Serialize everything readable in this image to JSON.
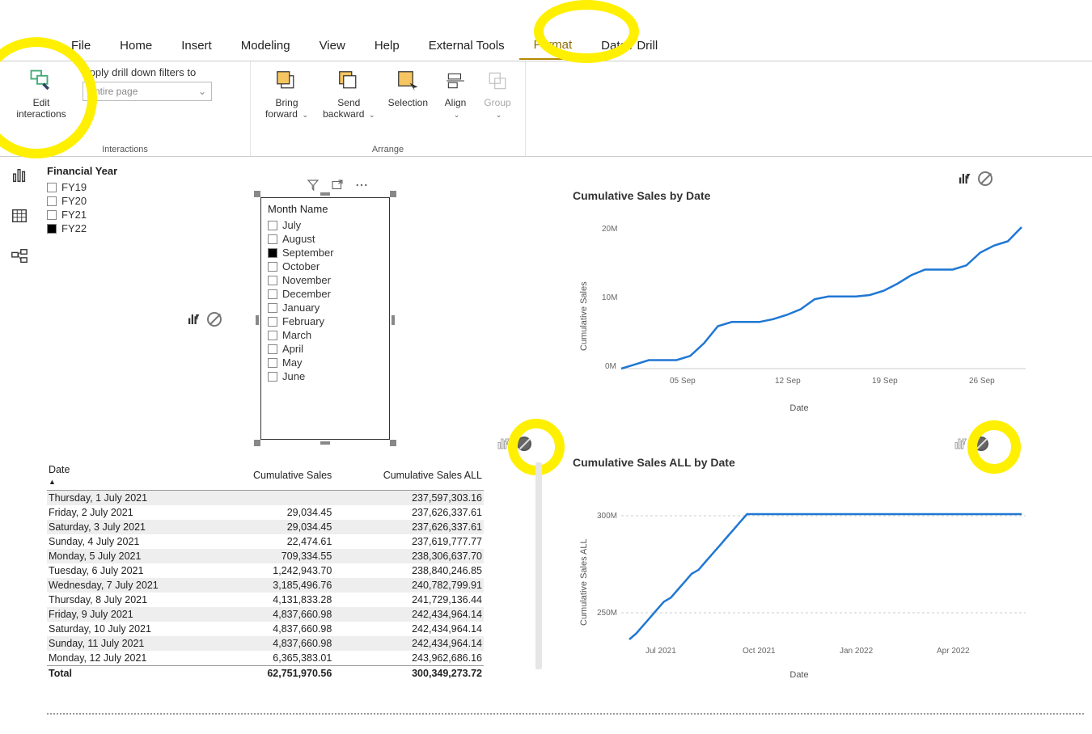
{
  "menu": {
    "items": [
      "File",
      "Home",
      "Insert",
      "Modeling",
      "View",
      "Help",
      "External Tools",
      "Format",
      "Data / Drill"
    ],
    "active": "Format"
  },
  "ribbon": {
    "interactions": {
      "edit_label": "Edit interactions",
      "drill_label": "Apply drill down filters to",
      "drill_value": "Entire page",
      "group_label": "Interactions"
    },
    "arrange": {
      "bring_forward": "Bring forward",
      "send_backward": "Send backward",
      "selection": "Selection",
      "align": "Align",
      "group": "Group",
      "group_label": "Arrange"
    }
  },
  "fy_slicer": {
    "title": "Financial Year",
    "items": [
      {
        "label": "FY19",
        "checked": false
      },
      {
        "label": "FY20",
        "checked": false
      },
      {
        "label": "FY21",
        "checked": false
      },
      {
        "label": "FY22",
        "checked": true
      }
    ]
  },
  "month_slicer": {
    "title": "Month Name",
    "items": [
      {
        "label": "July",
        "checked": false
      },
      {
        "label": "August",
        "checked": false
      },
      {
        "label": "September",
        "checked": true
      },
      {
        "label": "October",
        "checked": false
      },
      {
        "label": "November",
        "checked": false
      },
      {
        "label": "December",
        "checked": false
      },
      {
        "label": "January",
        "checked": false
      },
      {
        "label": "February",
        "checked": false
      },
      {
        "label": "March",
        "checked": false
      },
      {
        "label": "April",
        "checked": false
      },
      {
        "label": "May",
        "checked": false
      },
      {
        "label": "June",
        "checked": false
      }
    ]
  },
  "table": {
    "columns": [
      "Date",
      "Cumulative Sales",
      "Cumulative Sales ALL"
    ],
    "rows": [
      [
        "Thursday, 1 July 2021",
        "",
        "237,597,303.16"
      ],
      [
        "Friday, 2 July 2021",
        "29,034.45",
        "237,626,337.61"
      ],
      [
        "Saturday, 3 July 2021",
        "29,034.45",
        "237,626,337.61"
      ],
      [
        "Sunday, 4 July 2021",
        "22,474.61",
        "237,619,777.77"
      ],
      [
        "Monday, 5 July 2021",
        "709,334.55",
        "238,306,637.70"
      ],
      [
        "Tuesday, 6 July 2021",
        "1,242,943.70",
        "238,840,246.85"
      ],
      [
        "Wednesday, 7 July 2021",
        "3,185,496.76",
        "240,782,799.91"
      ],
      [
        "Thursday, 8 July 2021",
        "4,131,833.28",
        "241,729,136.44"
      ],
      [
        "Friday, 9 July 2021",
        "4,837,660.98",
        "242,434,964.14"
      ],
      [
        "Saturday, 10 July 2021",
        "4,837,660.98",
        "242,434,964.14"
      ],
      [
        "Sunday, 11 July 2021",
        "4,837,660.98",
        "242,434,964.14"
      ],
      [
        "Monday, 12 July 2021",
        "6,365,383.01",
        "243,962,686.16"
      ]
    ],
    "total": [
      "Total",
      "62,751,970.56",
      "300,349,273.72"
    ]
  },
  "chart_data": [
    {
      "type": "line",
      "title": "Cumulative Sales by Date",
      "xlabel": "Date",
      "ylabel": "Cumulative Sales",
      "ylim": [
        0,
        20000000
      ],
      "yticks": [
        "0M",
        "10M",
        "20M"
      ],
      "xticks": [
        "05 Sep",
        "12 Sep",
        "19 Sep",
        "26 Sep"
      ],
      "x": [
        1,
        2,
        3,
        4,
        5,
        6,
        7,
        8,
        9,
        10,
        11,
        12,
        13,
        14,
        15,
        16,
        17,
        18,
        19,
        20,
        21,
        22,
        23,
        24,
        25,
        26,
        27,
        28,
        29,
        30
      ],
      "values": [
        0,
        0.6,
        1.2,
        1.2,
        1.2,
        1.8,
        3.6,
        6.0,
        6.6,
        6.6,
        6.6,
        7.0,
        7.6,
        8.4,
        9.8,
        10.2,
        10.2,
        10.2,
        10.4,
        11.0,
        12.0,
        13.2,
        14.0,
        14.0,
        14.0,
        14.6,
        16.4,
        17.4,
        18.0,
        20.0
      ],
      "value_unit": "M"
    },
    {
      "type": "line",
      "title": "Cumulative Sales ALL by Date",
      "xlabel": "Date",
      "ylabel": "Cumulative Sales ALL",
      "ylim": [
        237000000,
        305000000
      ],
      "yticks": [
        "250M",
        "300M"
      ],
      "xticks": [
        "Jul 2021",
        "Oct 2021",
        "Jan 2022",
        "Apr 2022"
      ],
      "x": [
        "2021-07",
        "2021-08",
        "2021-09",
        "2021-10",
        "2021-11",
        "2021-12",
        "2022-01",
        "2022-02",
        "2022-03",
        "2022-04",
        "2022-05",
        "2022-06"
      ],
      "values": [
        237,
        260,
        280,
        300,
        300,
        300,
        300,
        300,
        300,
        300,
        300,
        300
      ],
      "value_unit": "M"
    }
  ]
}
